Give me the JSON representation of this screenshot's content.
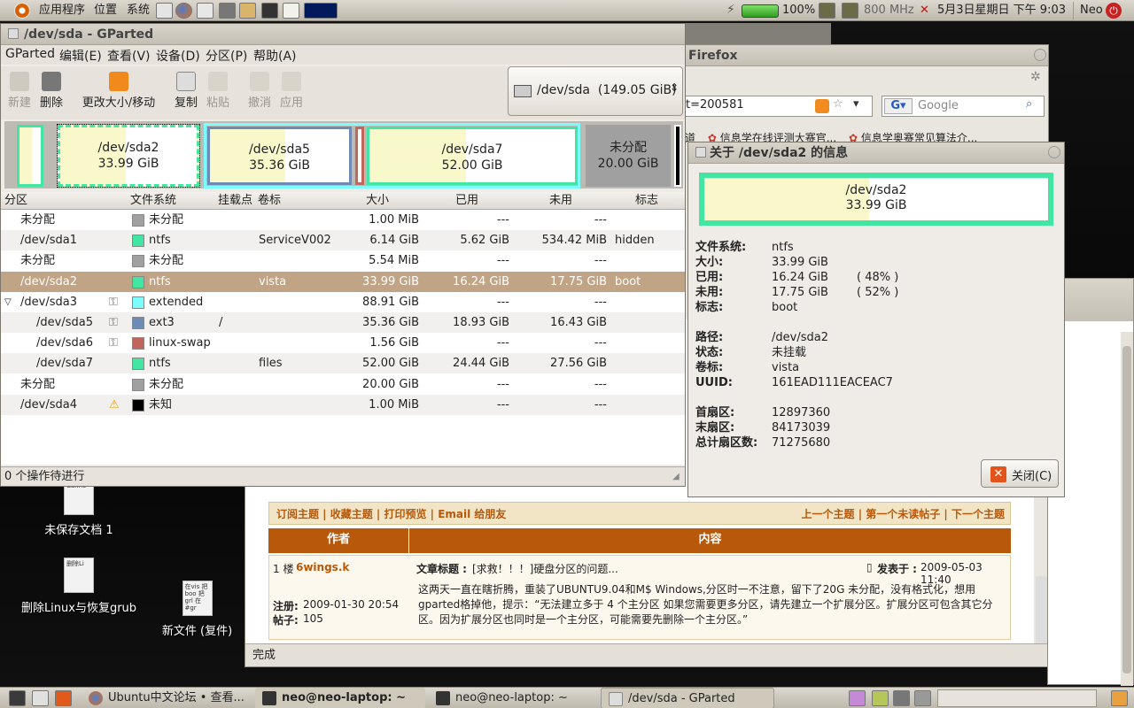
{
  "top_panel": {
    "menus": [
      "应用程序",
      "位置",
      "系统"
    ],
    "battery": "100%",
    "cpu_freq": "800 MHz",
    "datetime": "5月3日星期日 下午 9:03",
    "user": "Neo"
  },
  "gparted": {
    "title": "/dev/sda - GParted",
    "menu": [
      "GParted",
      "编辑(E)",
      "查看(V)",
      "设备(D)",
      "分区(P)",
      "帮助(A)"
    ],
    "toolbar": {
      "new": "新建",
      "delete": "删除",
      "resize": "更改大小/移动",
      "copy": "复制",
      "paste": "粘贴",
      "undo": "撤消",
      "apply": "应用"
    },
    "device_select": "/dev/sda  (149.05 GiB)",
    "map": [
      {
        "name": "/dev/sda2",
        "size": "33.99 GiB"
      },
      {
        "name": "/dev/sda5",
        "size": "35.36 GiB"
      },
      {
        "name": "/dev/sda7",
        "size": "52.00 GiB"
      },
      {
        "name": "未分配",
        "size": "20.00 GiB"
      }
    ],
    "headers": [
      "分区",
      "文件系统",
      "挂载点",
      "卷标",
      "大小",
      "已用",
      "未用",
      "标志"
    ],
    "rows": [
      {
        "part": "未分配",
        "fs": "未分配",
        "mount": "",
        "label": "",
        "size": "1.00 MiB",
        "used": "---",
        "unused": "---",
        "flags": "",
        "color": "#a0a0a0",
        "indent": 0,
        "key": false,
        "warn": false,
        "expander": false
      },
      {
        "part": "/dev/sda1",
        "fs": "ntfs",
        "mount": "",
        "label": "ServiceV002",
        "size": "6.14 GiB",
        "used": "5.62 GiB",
        "unused": "534.42 MiB",
        "flags": "hidden",
        "color": "#42e5a2",
        "indent": 0,
        "key": false,
        "warn": false,
        "expander": false
      },
      {
        "part": "未分配",
        "fs": "未分配",
        "mount": "",
        "label": "",
        "size": "5.54 MiB",
        "used": "---",
        "unused": "---",
        "flags": "",
        "color": "#a0a0a0",
        "indent": 0,
        "key": false,
        "warn": false,
        "expander": false
      },
      {
        "part": "/dev/sda2",
        "fs": "ntfs",
        "mount": "",
        "label": "vista",
        "size": "33.99 GiB",
        "used": "16.24 GiB",
        "unused": "17.75 GiB",
        "flags": "boot",
        "color": "#42e5a2",
        "indent": 0,
        "key": false,
        "warn": false,
        "expander": false,
        "selected": true
      },
      {
        "part": "/dev/sda3",
        "fs": "extended",
        "mount": "",
        "label": "",
        "size": "88.91 GiB",
        "used": "---",
        "unused": "---",
        "flags": "",
        "color": "#7dfcfe",
        "indent": 0,
        "key": true,
        "warn": false,
        "expander": true
      },
      {
        "part": "/dev/sda5",
        "fs": "ext3",
        "mount": "/",
        "label": "",
        "size": "35.36 GiB",
        "used": "18.93 GiB",
        "unused": "16.43 GiB",
        "flags": "",
        "color": "#6e8bb5",
        "indent": 1,
        "key": true,
        "warn": false,
        "expander": false
      },
      {
        "part": "/dev/sda6",
        "fs": "linux-swap",
        "mount": "",
        "label": "",
        "size": "1.56 GiB",
        "used": "---",
        "unused": "---",
        "flags": "",
        "color": "#c1665a",
        "indent": 1,
        "key": true,
        "warn": false,
        "expander": false
      },
      {
        "part": "/dev/sda7",
        "fs": "ntfs",
        "mount": "",
        "label": "files",
        "size": "52.00 GiB",
        "used": "24.44 GiB",
        "unused": "27.56 GiB",
        "flags": "",
        "color": "#42e5a2",
        "indent": 1,
        "key": false,
        "warn": false,
        "expander": false
      },
      {
        "part": "未分配",
        "fs": "未分配",
        "mount": "",
        "label": "",
        "size": "20.00 GiB",
        "used": "---",
        "unused": "---",
        "flags": "",
        "color": "#a0a0a0",
        "indent": 0,
        "key": false,
        "warn": false,
        "expander": false
      },
      {
        "part": "/dev/sda4",
        "fs": "未知",
        "mount": "",
        "label": "",
        "size": "1.00 MiB",
        "used": "---",
        "unused": "---",
        "flags": "",
        "color": "#000000",
        "indent": 0,
        "key": false,
        "warn": true,
        "expander": false
      }
    ],
    "status": "0 个操作待进行"
  },
  "info": {
    "title": "关于 /dev/sda2 的信息",
    "bar_name": "/dev/sda2",
    "bar_size": "33.99 GiB",
    "used_fraction": 0.48,
    "labels": {
      "fs": "文件系统:",
      "size": "大小:",
      "used": "已用:",
      "unused": "未用:",
      "flags": "标志:",
      "path": "路径:",
      "state": "状态:",
      "label": "卷标:",
      "uuid": "UUID:",
      "first": "首扇区:",
      "last": "末扇区:",
      "total": "总计扇区数:"
    },
    "values": {
      "fs": "ntfs",
      "size": "33.99 GiB",
      "used": "16.24 GiB",
      "used_pct": "( 48% )",
      "unused": "17.75 GiB",
      "unused_pct": "( 52% )",
      "flags": "boot",
      "path": "/dev/sda2",
      "state": "未挂载",
      "label": "vista",
      "uuid": "161EAD111EACEAC7",
      "first": "12897360",
      "last": "84173039",
      "total": "71275680"
    },
    "close_label": "关闭(C)"
  },
  "firefox": {
    "title": "Firefox",
    "url": "t=200581",
    "search_placeholder": "Google",
    "bookmarks": [
      "道",
      "信息学在线评测大赛官...",
      "信息学奥赛常见算法介..."
    ],
    "status": "完成",
    "forum": {
      "links_left": "订阅主题 | 收藏主题 | 打印预览 | Email 给朋友",
      "links_right": "上一个主题 | 第一个未读帖子 | 下一个主题",
      "col_author": "作者",
      "col_content": "内容",
      "floor": "1 楼",
      "author": "6wings.k",
      "subject_label": "文章标题 :",
      "subject": "[求救！！！]硬盘分区的问题...",
      "posted_label": "发表于 :",
      "posted": "2009-05-03 11:40",
      "reg_label": "注册:",
      "reg": "2009-01-30 20:54",
      "posts_label": "帖子:",
      "posts": "105",
      "body": "这两天一直在瞎折腾，重装了UBUNTU9.04和M$ Windows,分区时一不注意，留下了20G 未分配，没有格式化，想用gparted格掉他，提示：“无法建立多于 4 个主分区 如果您需要更多分区，请先建立一个扩展分区。扩展分区可包含其它分区。因为扩展分区也同时是一个主分区，可能需要先删除一个主分区。”"
    }
  },
  "desktop_icons": [
    {
      "label": "未保存文档 1",
      "doc": "Canno"
    },
    {
      "label": "删除Linux与恢复grub",
      "doc": "删除Li"
    },
    {
      "label": "新文件 (复件)",
      "doc": "在vis 把boo 把grl 在#gr"
    }
  ],
  "taskbar": [
    {
      "label": "Ubuntu中文论坛 • 查看..."
    },
    {
      "label": "neo@neo-laptop: ~"
    },
    {
      "label": "neo@neo-laptop: ~"
    },
    {
      "label": "/dev/sda - GParted"
    }
  ]
}
